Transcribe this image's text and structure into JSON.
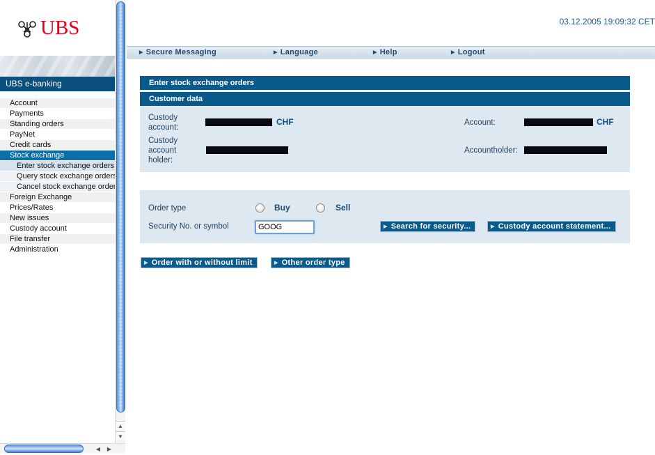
{
  "brand": {
    "name": "UBS",
    "section_title": "UBS e-banking"
  },
  "datetime": "03.12.2005 19:09:32 CET",
  "topnav": [
    {
      "label": "Secure Messaging"
    },
    {
      "label": "Language"
    },
    {
      "label": "Help"
    },
    {
      "label": "Logout"
    }
  ],
  "sidebar": {
    "items": [
      {
        "label": "Account"
      },
      {
        "label": "Payments"
      },
      {
        "label": "Standing orders"
      },
      {
        "label": "PayNet"
      },
      {
        "label": "Credit cards"
      },
      {
        "label": "Stock exchange"
      },
      {
        "label": "Enter stock exchange orders"
      },
      {
        "label": "Query stock exchange orders"
      },
      {
        "label": "Cancel stock exchange orders"
      },
      {
        "label": "Foreign Exchange"
      },
      {
        "label": "Prices/Rates"
      },
      {
        "label": "New issues"
      },
      {
        "label": "Custody account"
      },
      {
        "label": "File transfer"
      },
      {
        "label": "Administration"
      }
    ]
  },
  "page": {
    "title": "Enter stock exchange orders",
    "customer_section": "Customer data",
    "custody_account_label": "Custody account:",
    "custody_account_currency": "CHF",
    "custody_holder_label": "Custody account holder:",
    "account_label": "Account:",
    "account_currency": "CHF",
    "accountholder_label": "Accountholder:"
  },
  "order": {
    "order_type_label": "Order type",
    "buy_label": "Buy",
    "sell_label": "Sell",
    "security_label": "Security No. or symbol",
    "security_value": "GOOG",
    "search_button": "Search for security...",
    "statement_button": "Custody account statement..."
  },
  "actions": {
    "order_limit_button": "Order with or without limit",
    "other_order_button": "Other order type"
  },
  "colors": {
    "brand_red": "#e2001a",
    "primary_blue": "#0b5a8c",
    "panel_bg": "#dde8f1"
  }
}
